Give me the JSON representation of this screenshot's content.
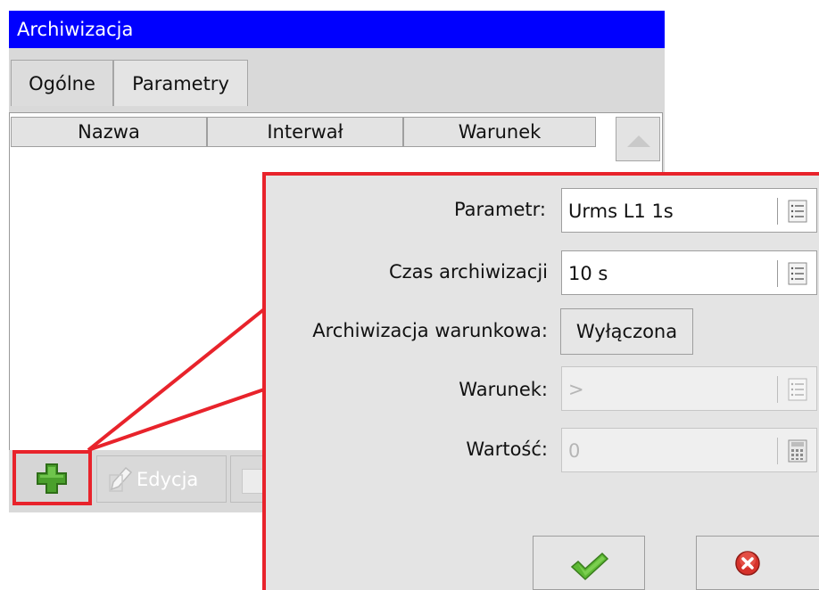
{
  "window": {
    "title": "Archiwizacja"
  },
  "tabs": [
    {
      "label": "Ogólne"
    },
    {
      "label": "Parametry"
    }
  ],
  "table": {
    "columns": [
      "Nazwa",
      "Interwał",
      "Warunek"
    ],
    "rows": []
  },
  "toolbar": {
    "add_icon": "plus-icon",
    "edit_label": "Edycja",
    "edit_icon": "pencil-icon"
  },
  "dialog": {
    "parametr": {
      "label": "Parametr:",
      "value": "Urms L1 1s",
      "icon": "list-icon"
    },
    "czas": {
      "label": "Czas archiwizacji",
      "value": "10 s",
      "icon": "list-icon"
    },
    "warunkowa": {
      "label": "Archiwizacja warunkowa:",
      "value": "Wyłączona"
    },
    "warunek": {
      "label": "Warunek:",
      "value": ">",
      "icon": "list-icon"
    },
    "wartosc": {
      "label": "Wartość:",
      "value": "0",
      "icon": "calculator-icon"
    },
    "ok_icon": "checkmark-icon",
    "cancel_icon": "cancel-icon"
  },
  "colors": {
    "titlebar": "#0000ff",
    "highlight": "#e8232b",
    "ok_green": "#5cb833",
    "cancel_red": "#d6322b"
  }
}
